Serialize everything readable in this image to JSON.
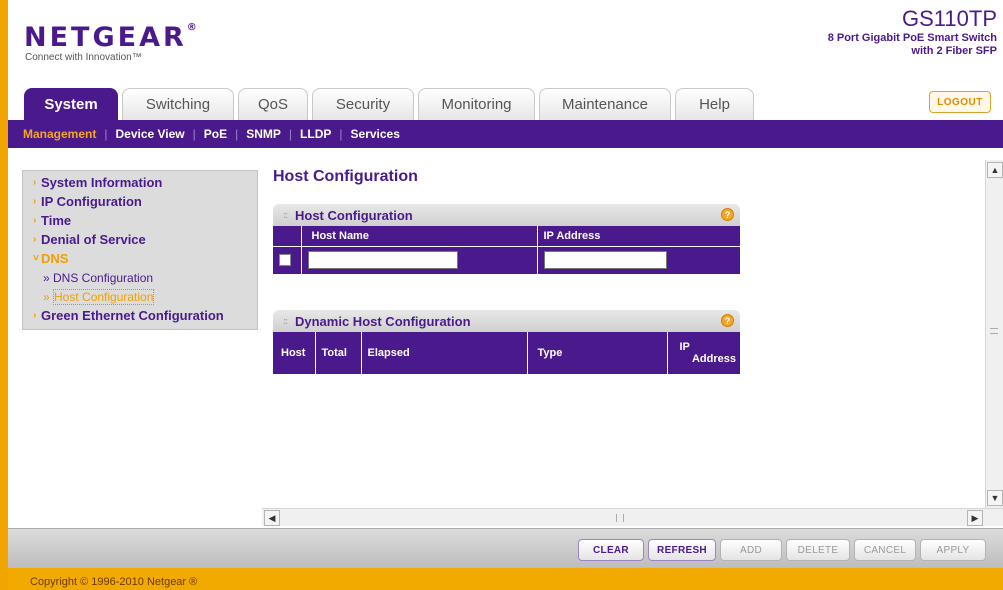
{
  "header": {
    "brand": "NETGEAR",
    "tagline": "Connect with Innovation™",
    "model": "GS110TP",
    "description_line1": "8 Port Gigabit PoE Smart Switch",
    "description_line2": "with 2 Fiber SFP"
  },
  "tabs": [
    {
      "label": "System",
      "active": true
    },
    {
      "label": "Switching"
    },
    {
      "label": "QoS"
    },
    {
      "label": "Security"
    },
    {
      "label": "Monitoring"
    },
    {
      "label": "Maintenance"
    },
    {
      "label": "Help"
    }
  ],
  "logout_label": "LOGOUT",
  "subnav": [
    {
      "label": "Management",
      "active": true
    },
    {
      "label": "Device View"
    },
    {
      "label": "PoE"
    },
    {
      "label": "SNMP"
    },
    {
      "label": "LLDP"
    },
    {
      "label": "Services"
    }
  ],
  "sidebar": {
    "items": [
      {
        "label": "System Information"
      },
      {
        "label": "IP Configuration"
      },
      {
        "label": "Time"
      },
      {
        "label": "Denial of Service"
      },
      {
        "label": "DNS"
      },
      {
        "label": "DNS Configuration"
      },
      {
        "label": "Host Configuration"
      },
      {
        "label": "Green Ethernet Configuration"
      }
    ]
  },
  "page_title": "Host Configuration",
  "host_config": {
    "title": "Host Configuration",
    "columns": [
      "Host Name",
      "IP Address"
    ],
    "row": {
      "host_name": "",
      "ip_address": ""
    }
  },
  "dynamic_host": {
    "title": "Dynamic Host Configuration",
    "columns": [
      "Host",
      "Total",
      "Elapsed",
      "Type",
      "IP",
      "Address"
    ]
  },
  "buttons": {
    "clear": "CLEAR",
    "refresh": "REFRESH",
    "add": "ADD",
    "delete": "DELETE",
    "cancel": "CANCEL",
    "apply": "APPLY"
  },
  "copyright": "Copyright © 1996-2010 Netgear ®",
  "colors": {
    "brand_purple": "#4a1a8c",
    "accent_orange": "#f0a500"
  }
}
